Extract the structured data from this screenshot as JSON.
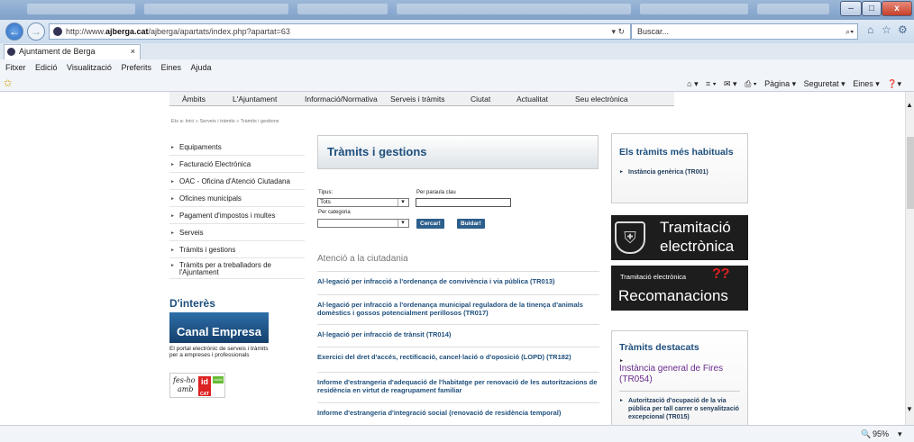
{
  "window": {
    "controls": {
      "minimize": "–",
      "maximize": "□",
      "close": "x"
    }
  },
  "address": {
    "url_prefix": "http://www.",
    "url_domain": "ajberga.cat",
    "url_path": "/ajberga/apartats/index.php?apartat=63",
    "refresh": "▾ ↻",
    "search_placeholder": "Buscar..."
  },
  "tab": {
    "title": "Ajuntament de Berga",
    "close": "×"
  },
  "menu": {
    "items": [
      "Fitxer",
      "Edició",
      "Visualització",
      "Preferits",
      "Eines",
      "Ajuda"
    ]
  },
  "commandbar": {
    "items": [
      "Pàgina ▾",
      "Seguretat ▾",
      "Eines ▾"
    ]
  },
  "status": {
    "zoom": "95%"
  },
  "site": {
    "topnav": [
      "Àmbits",
      "L'Ajuntament",
      "Informació/Normativa",
      "Serveis i tràmits",
      "Ciutat",
      "Actualitat",
      "Seu electrònica"
    ],
    "breadcrumb": "Ets a: Inici » Serveis i tràmits » Tràmits i gestions",
    "leftnav": [
      "Equipaments",
      "Facturació Electrònica",
      "OAC - Oficina d'Atenció Ciutadana",
      "Oficines municipals",
      "Pagament d'impostos i multes",
      "Serveis",
      "Tràmits i gestions",
      "Tràmits per a treballadors de l'Ajuntament"
    ],
    "dinteres": "D'interès",
    "canal": "Canal Empresa",
    "canal_desc": "El portal electrònic de serveis i tràmits per a empreses i professionals",
    "idcat": {
      "fesho": "fes-ho",
      "amb": "amb",
      "id": "id",
      "cat": "CAT",
      "mobil": "mòbil"
    },
    "main_title": "Tràmits i gestions",
    "form": {
      "tipus_label": "Tipus:",
      "tipus_value": "Tots",
      "paraula_label": "Per paraula clau",
      "categoria_label": "Per categoria",
      "cercar": "Cercar!",
      "buidar": "Buidar!"
    },
    "section": "Atenció a la ciutadania",
    "items": [
      "Al·legació per infracció a l'ordenança de convivència i via pública (TR013)",
      "Al·legació per infracció a l'ordenança municipal reguladora de la tinença d'animals domèstics i gossos potencialment perillosos (TR017)",
      "Al·legació per infracció de trànsit (TR014)",
      "Exercici del dret d'accés, rectificació, cancel·lació o d'oposició (LOPD) (TR182)",
      "Informe d'estrangeria d'adequació de l'habitatge per renovació de les autoritzacions de residència en virtut de reagrupament familiar",
      "Informe d'estrangeria d'integració social (renovació de residència temporal)"
    ],
    "right": {
      "habituals_title": "Els tràmits més habituals",
      "habituals_link": "Instància genèrica (TR001)",
      "tram_line1": "Tramitació",
      "tram_line2": "electrònica",
      "rec_small": "Tramitació electrònica",
      "rec_big": "Recomanacions",
      "rec_q": "??",
      "destacats_title": "Tràmits destacats",
      "destacats_1": "Instància general de Fires (TR054)",
      "destacats_2": "Autorització d'ocupació de la via pública per tall carrer o senyalització excepcional (TR015)"
    }
  }
}
